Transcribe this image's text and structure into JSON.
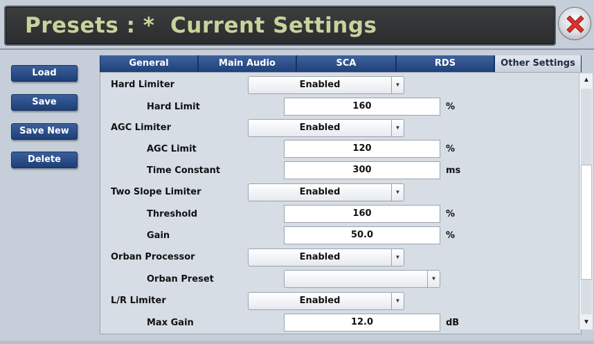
{
  "header": {
    "title": "Presets : *  Current Settings",
    "close_icon": "close-red-x-icon"
  },
  "sidebar": {
    "buttons": [
      {
        "label": "Load"
      },
      {
        "label": "Save"
      },
      {
        "label": "Save New"
      },
      {
        "label": "Delete"
      }
    ]
  },
  "tabs": [
    {
      "label": "General"
    },
    {
      "label": "Main Audio"
    },
    {
      "label": "SCA"
    },
    {
      "label": "RDS"
    },
    {
      "label": "Other Settings",
      "active": true
    }
  ],
  "settings": {
    "hard_limiter": {
      "label": "Hard Limiter",
      "value": "Enabled"
    },
    "hard_limit": {
      "label": "Hard Limit",
      "value": "160",
      "unit": "%"
    },
    "agc_limiter": {
      "label": "AGC Limiter",
      "value": "Enabled"
    },
    "agc_limit": {
      "label": "AGC Limit",
      "value": "120",
      "unit": "%"
    },
    "time_constant": {
      "label": "Time Constant",
      "value": "300",
      "unit": "ms"
    },
    "two_slope_limiter": {
      "label": "Two Slope Limiter",
      "value": "Enabled"
    },
    "threshold": {
      "label": "Threshold",
      "value": "160",
      "unit": "%"
    },
    "gain": {
      "label": "Gain",
      "value": "50.0",
      "unit": "%"
    },
    "orban_processor": {
      "label": "Orban Processor",
      "value": "Enabled"
    },
    "orban_preset": {
      "label": "Orban Preset",
      "value": ""
    },
    "lr_limiter": {
      "label": "L/R Limiter",
      "value": "Enabled"
    },
    "max_gain": {
      "label": "Max Gain",
      "value": "12.0",
      "unit": "dB"
    }
  },
  "scrollbar": {
    "up_icon": "triangle-up-icon",
    "down_icon": "triangle-down-icon"
  },
  "colors": {
    "title": "#c8d39b",
    "button_blue": "#2a4c86",
    "close_red": "#e0322b"
  }
}
